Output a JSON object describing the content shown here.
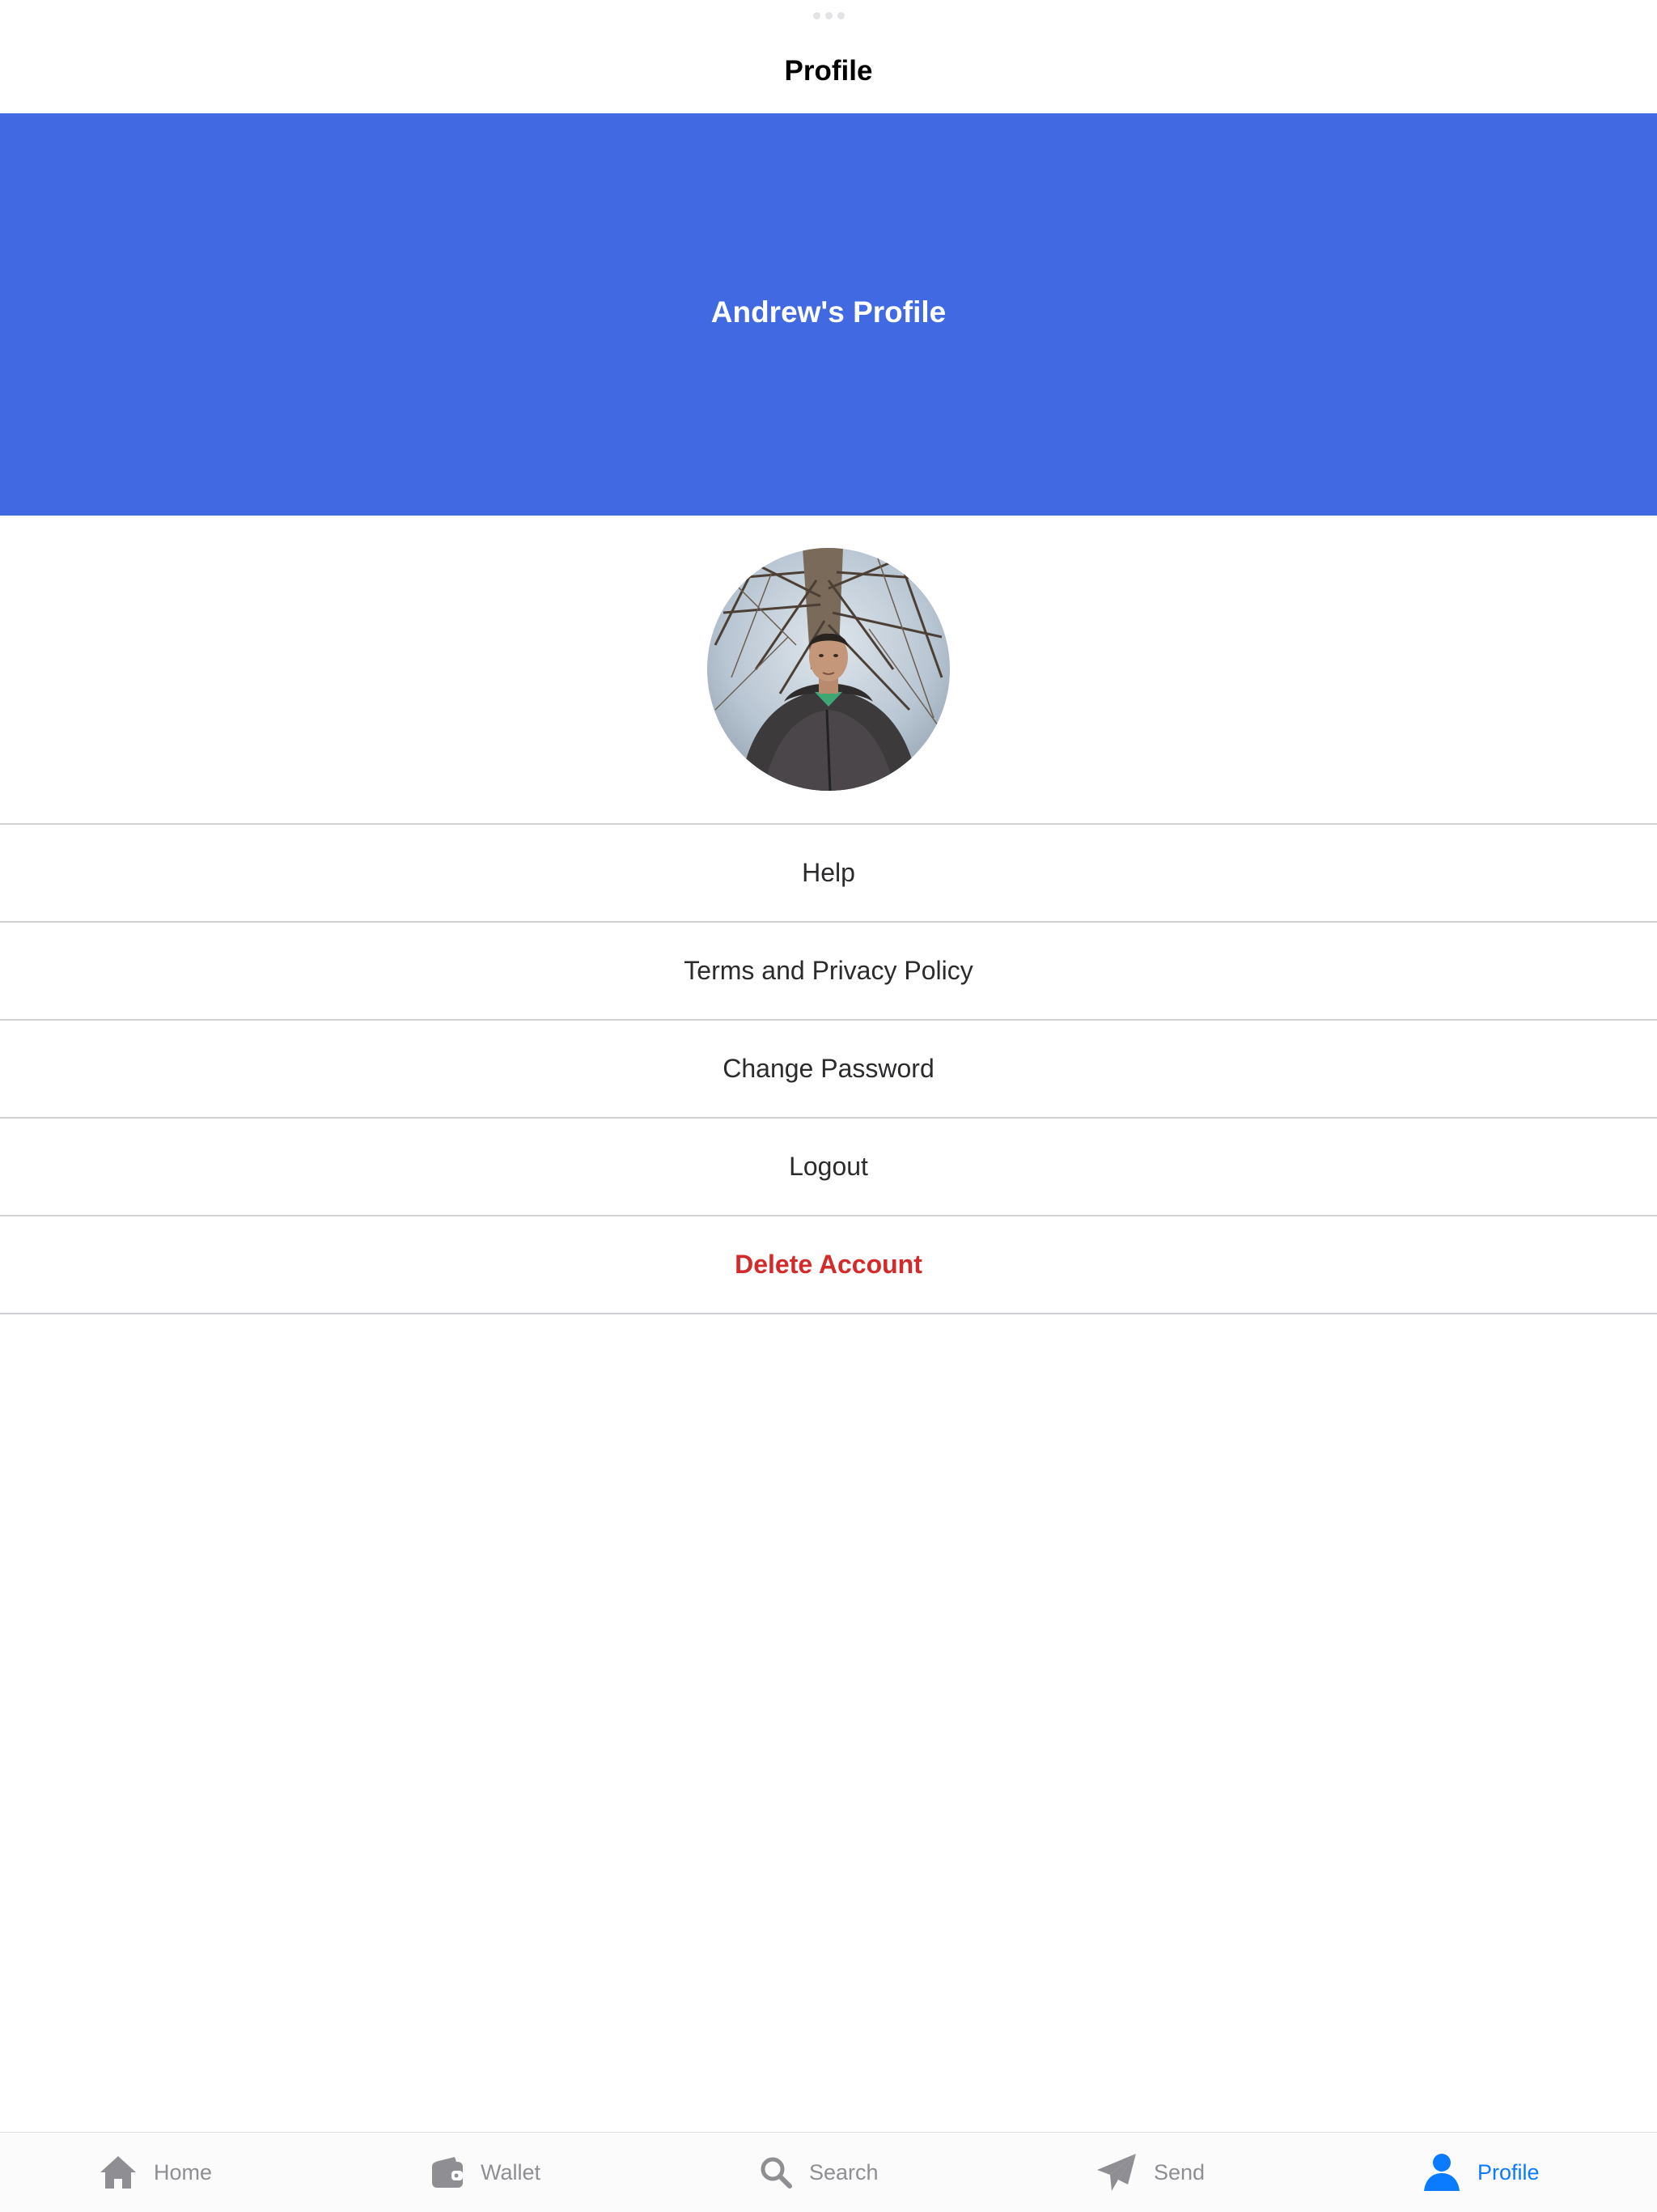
{
  "nav": {
    "title": "Profile"
  },
  "header": {
    "title": "Andrew's Profile",
    "background_color": "#4169E1"
  },
  "avatar": {
    "description_icon": "profile-photo"
  },
  "menu": {
    "items": [
      {
        "label": "Help"
      },
      {
        "label": "Terms and Privacy Policy"
      },
      {
        "label": "Change Password"
      },
      {
        "label": "Logout"
      },
      {
        "label": "Delete Account"
      }
    ],
    "danger_color": "#D42A2A"
  },
  "tabs": {
    "active_color": "#0A7AFF",
    "inactive_color": "#8E8E93",
    "items": [
      {
        "label": "Home",
        "icon": "house-icon"
      },
      {
        "label": "Wallet",
        "icon": "wallet-icon"
      },
      {
        "label": "Search",
        "icon": "magnifier-icon"
      },
      {
        "label": "Send",
        "icon": "paper-plane-icon"
      },
      {
        "label": "Profile",
        "icon": "person-icon",
        "active": true
      }
    ]
  }
}
